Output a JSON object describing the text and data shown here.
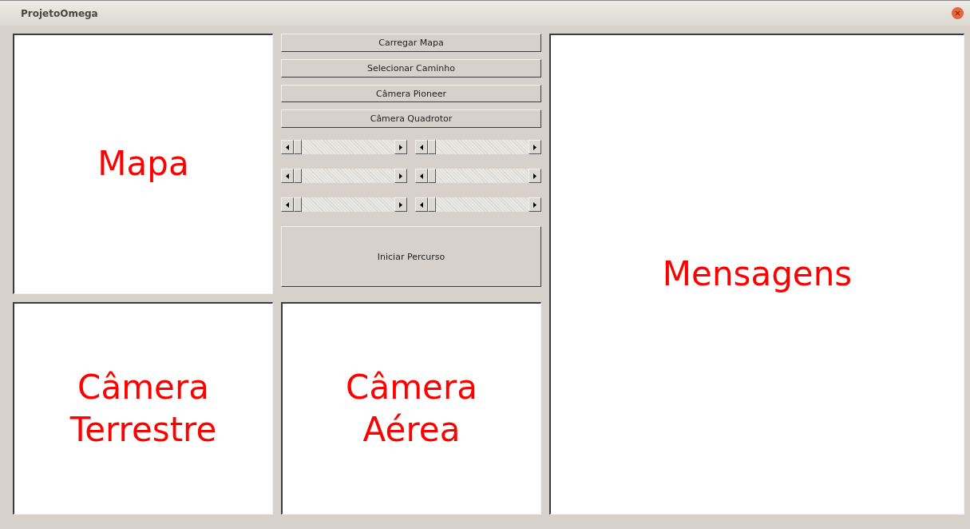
{
  "window": {
    "title": "ProjetoOmega"
  },
  "map": {
    "label": "Mapa"
  },
  "buttons": [
    "Carregar Mapa",
    "Selecionar Caminho",
    "Câmera Pioneer",
    "Câmera Quadrotor"
  ],
  "sliders": [
    {
      "level": 0
    },
    {
      "level": 0
    },
    {
      "level": 0
    },
    {
      "level": 0
    },
    {
      "level": 0
    },
    {
      "level": 0
    }
  ],
  "start_button": "Iniciar Percurso",
  "messages": {
    "label": "Mensagens"
  },
  "ground_camera": {
    "label": "Câmera Terrestre"
  },
  "aerial_camera": {
    "label": "Câmera Aérea"
  }
}
